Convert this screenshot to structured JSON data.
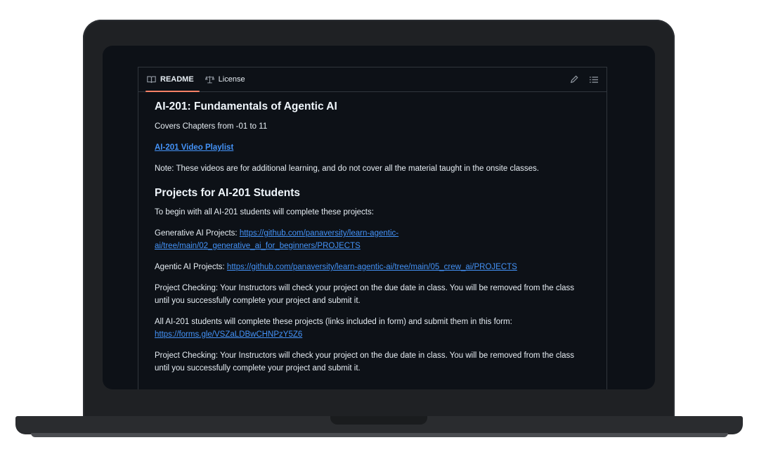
{
  "tabs": [
    {
      "label": "README",
      "icon": "book-icon",
      "active": true
    },
    {
      "label": "License",
      "icon": "scale-icon",
      "active": false
    }
  ],
  "toolbar": {
    "edit_icon": "pencil-icon",
    "outline_icon": "list-icon"
  },
  "readme": {
    "title": "AI-201: Fundamentals of Agentic AI",
    "chapters": "Covers Chapters from -01 to 11",
    "playlist_link": "AI-201 Video Playlist",
    "note": "Note: These videos are for additional learning, and do not cover all the material taught in the onsite classes.",
    "projects_heading": "Projects for AI-201 Students",
    "intro": "To begin with all AI-201 students will complete these projects:",
    "gen_label": "Generative AI Projects: ",
    "gen_link_line1": "https://github.com/panaversity/learn-agentic-",
    "gen_link_line2": "ai/tree/main/02_generative_ai_for_beginners/PROJECTS",
    "agentic_label": "Agentic AI Projects: ",
    "agentic_link": "https://github.com/panaversity/learn-agentic-ai/tree/main/05_crew_ai/PROJECTS",
    "checking_1_line1": "Project Checking: Your Instructors will check your project on the due date in class. You will be removed from the class",
    "checking_1_line2": "until you successfully complete your project and submit it.",
    "form_text": "All AI-201 students will complete these projects (links included in form) and submit them in this form:",
    "form_link": "https://forms.gle/VSZaLDBwCHNPzY5Z6",
    "checking_2_line1": "Project Checking: Your Instructors will check your project on the due date in class. You will be removed from the class",
    "checking_2_line2": "until you successfully complete your project and submit it."
  },
  "colors": {
    "accent": "#f78166",
    "link": "#4493f8",
    "background": "#0d1117"
  }
}
